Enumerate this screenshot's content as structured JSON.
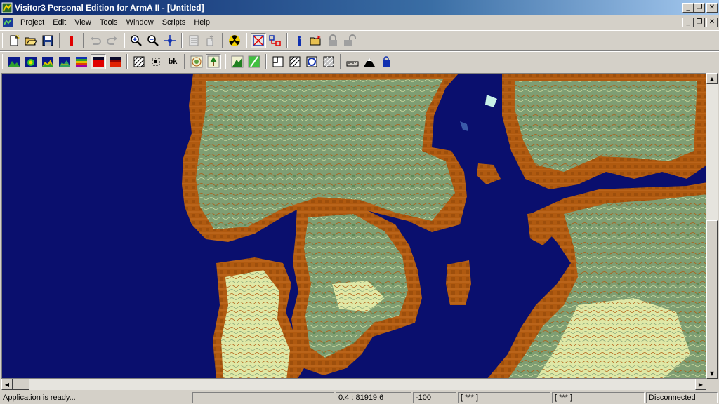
{
  "window": {
    "title": "Visitor3 Personal Edition for ArmA II - [Untitled]"
  },
  "window_controls": {
    "minimize": "_",
    "restore": "❐",
    "close": "✕"
  },
  "menu": [
    "Project",
    "Edit",
    "View",
    "Tools",
    "Window",
    "Scripts",
    "Help"
  ],
  "toolbar1": {
    "buttons": [
      "new-icon",
      "open-icon",
      "save-icon",
      "alert-icon",
      "undo-icon",
      "redo-icon",
      "zoom-in-icon",
      "zoom-out-icon",
      "center-icon",
      "properties-icon",
      "export-icon",
      "radiation-icon",
      "select-icon",
      "link-icon",
      "info-icon",
      "open-folder-icon",
      "lock-icon",
      "unlock-icon"
    ]
  },
  "toolbar2": {
    "buttons": [
      "terrain-view-icon",
      "heightmap-view-icon",
      "satellite-view-icon",
      "mixed-view-icon",
      "layer-colors-icon",
      "red-view-icon",
      "red-gradient-icon",
      "grid-hatch-icon",
      "grid-dots-icon",
      "contour-icon",
      "tree-icon",
      "forest-icon",
      "rivers-icon",
      "roads-icon",
      "frame-icon",
      "hatch-frame-icon",
      "circle-frame-icon",
      "fill-frame-icon",
      "ruler-icon",
      "mountain-icon",
      "bucket-icon"
    ],
    "bk_label": "bk"
  },
  "status": {
    "message": "Application is ready...",
    "coordinates": "0.4 : 81919.6",
    "height": "-100",
    "field1": "[ *** ]",
    "field2": "[ *** ]",
    "connection": "Disconnected"
  },
  "colors": {
    "water": "#0a0f6e",
    "land_brown": "#b05a10",
    "land_green": "#7f9e73",
    "land_light": "#e8f0b0",
    "shallow": "#c8f0e8"
  }
}
